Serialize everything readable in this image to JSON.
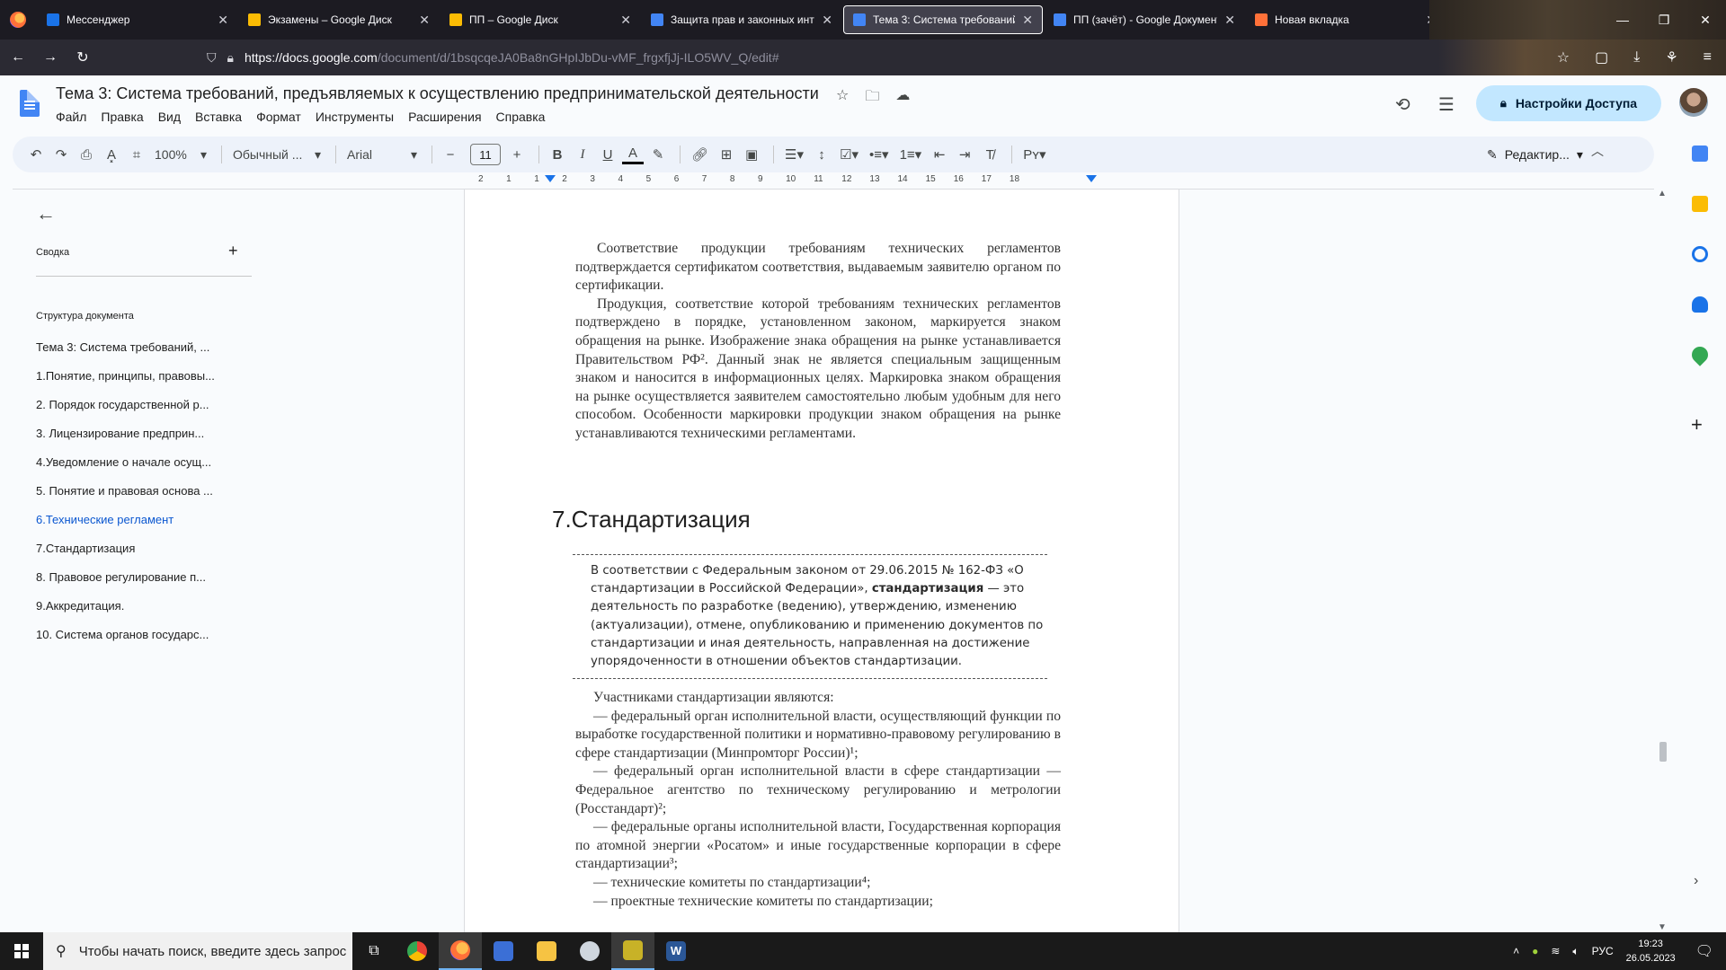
{
  "browser": {
    "tabs": [
      {
        "title": "Мессенджер",
        "color": "#1a73e8",
        "active": false
      },
      {
        "title": "Экзамены – Google Диск",
        "color": "#fbbc04",
        "active": false
      },
      {
        "title": "ПП – Google Диск",
        "color": "#fbbc04",
        "active": false
      },
      {
        "title": "Защита прав и законных инте",
        "color": "#4285f4",
        "active": false
      },
      {
        "title": "Тема 3: Система требований,",
        "color": "#4285f4",
        "active": true
      },
      {
        "title": "ПП (зачёт) - Google Документ",
        "color": "#4285f4",
        "active": false
      },
      {
        "title": "Новая вкладка",
        "color": "#ff7139",
        "active": false
      }
    ],
    "url_host": "https://docs.google.com",
    "url_path": "/document/d/1bsqcqeJA0Ba8nGHpIJbDu-vMF_frgxfjJj-ILO5WV_Q/edit#"
  },
  "doc": {
    "title": "Тема 3: Система требований, предъявляемых к осуществлению предпринимательской деятельности",
    "menu": [
      "Файл",
      "Правка",
      "Вид",
      "Вставка",
      "Формат",
      "Инструменты",
      "Расширения",
      "Справка"
    ],
    "share_label": "Настройки Доступа"
  },
  "toolbar": {
    "zoom": "100%",
    "style": "Обычный ...",
    "font": "Arial",
    "font_size": "11",
    "edit_mode": "Редактир..."
  },
  "ruler": [
    "2",
    "1",
    "1",
    "2",
    "3",
    "4",
    "5",
    "6",
    "7",
    "8",
    "9",
    "10",
    "11",
    "12",
    "13",
    "14",
    "15",
    "16",
    "17",
    "18"
  ],
  "outline": {
    "summary_label": "Сводка",
    "structure_label": "Структура документа",
    "items": [
      "Тема 3: Система требований, ...",
      "1.Понятие, принципы, правовы...",
      "2. Порядок государственной р...",
      "3. Лицензирование предприн...",
      "4.Уведомление о начале осущ...",
      "5. Понятие и правовая основа ...",
      "6.Технические регламент",
      "7.Стандартизация",
      "8. Правовое регулирование п...",
      "9.Аккредитация.",
      "10. Система органов государс..."
    ],
    "active_index": 6
  },
  "page": {
    "scan1": [
      "Соответствие продукции требованиям технических регламентов подтверждается сертификатом соответствия, выдаваемым заявителю органом по сертификации.",
      "Продукция, соответствие которой требованиям технических регламентов подтверждено в порядке, установленном законом, маркируется знаком обращения на рынке. Изображение знака обращения на рынке устанавливается Правительством РФ². Данный знак не является специальным защищенным знаком и наносится в информационных целях. Маркировка знаком обращения на рынке осуществляется заявителем самостоятельно любым удобным для него способом. Особенности маркировки продукции знаком обращения на рынке устанавливаются техническими регламентами."
    ],
    "heading": "7.Стандартизация",
    "box_before": "В соответствии с Федеральным законом от 29.06.2015 № 162-ФЗ «О стандартизации в Российской Федерации», ",
    "box_bold": "стандартизация",
    "box_after": " — это деятельность по разработке (ведению), утверждению, изменению (актуализации), отмене, опубликованию и применению документов по стандартизации и иная деятельность, направленная на достижение упорядоченности в отношении объектов стандартизации.",
    "scan2": [
      "Участниками стандартизации являются:",
      "— федеральный орган исполнительной власти, осуществляющий функции по выработке государственной политики и нормативно-правовому регулированию в сфере стандартизации (Минпромторг России)¹;",
      "— федеральный орган исполнительной власти в сфере стандартизации — Федеральное агентство по техническому регулированию и метрологии (Росстандарт)²;",
      "— федеральные органы исполнительной власти, Государственная корпорация по атомной энергии «Росатом» и иные государственные корпорации в сфере стандартизации³;",
      "— технические комитеты по стандартизации⁴;",
      "— проектные технические комитеты по стандартизации;"
    ]
  },
  "taskbar": {
    "search_placeholder": "Чтобы начать поиск, введите здесь запрос",
    "lang": "РУС",
    "time": "19:23",
    "date": "26.05.2023"
  }
}
